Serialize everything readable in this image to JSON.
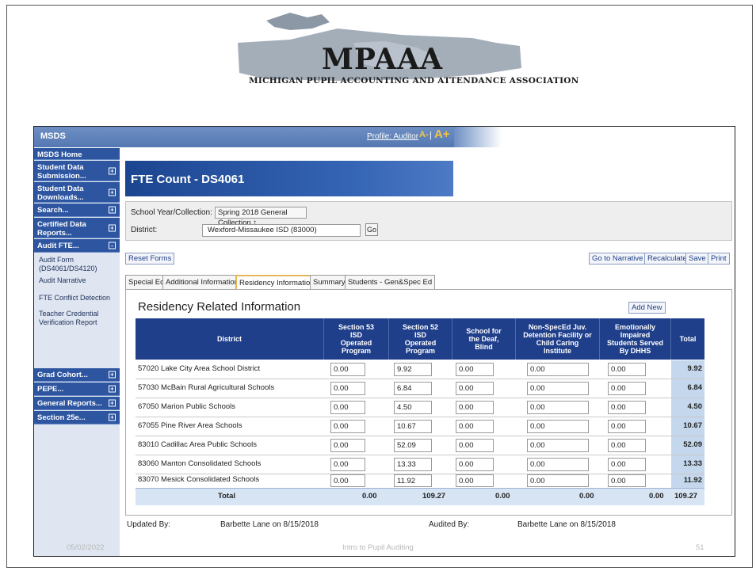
{
  "banner": {
    "title": "MPAAA",
    "subtitle": "MICHIGAN PUPIL ACCOUNTING AND ATTENDANCE ASSOCIATION"
  },
  "app": {
    "name": "MSDS",
    "profile_link": "Profile: Auditor",
    "font_small": "A-",
    "font_separator": "|",
    "font_large": "A+"
  },
  "sidebar": {
    "items": [
      {
        "label": "MSDS Home",
        "expand": ""
      },
      {
        "label": "Student Data Submission...",
        "expand": "+"
      },
      {
        "label": "Student Data Downloads...",
        "expand": "+"
      },
      {
        "label": "Search...",
        "expand": "+"
      },
      {
        "label": "Certified Data Reports...",
        "expand": "+"
      },
      {
        "label": "Audit FTE...",
        "expand": "-"
      },
      {
        "label": "Grad Cohort...",
        "expand": "+"
      },
      {
        "label": "PEPE...",
        "expand": "+"
      },
      {
        "label": "General Reports...",
        "expand": "+"
      },
      {
        "label": "Section 25e...",
        "expand": "+"
      }
    ],
    "audit_sub_items": [
      "Audit Form (DS4061/DS4120)",
      "Audit Narrative",
      "FTE Conflict Detection",
      "Teacher Credential Verification Report"
    ]
  },
  "page": {
    "title": "FTE Count - DS4061"
  },
  "filters": {
    "school_year_label": "School Year/Collection:",
    "school_year_value": "Spring 2018 General Collection ↕",
    "district_label": "District:",
    "district_value": "Wexford-Missaukee ISD (83000)",
    "go_label": "Go"
  },
  "toolbar": {
    "reset": "Reset Forms",
    "narrative": "Go to Narrative",
    "recalculate": "Recalculate",
    "save": "Save",
    "print": "Print"
  },
  "tabs": [
    {
      "label": "Special Ed",
      "active": false
    },
    {
      "label": "Additional Information",
      "active": false
    },
    {
      "label": "Residency Information",
      "active": true
    },
    {
      "label": "Summary",
      "active": false
    },
    {
      "label": "Students - Gen&Spec Ed",
      "active": false
    }
  ],
  "section": {
    "title": "Residency Related Information",
    "add_new": "Add New"
  },
  "table": {
    "headers": [
      "District",
      "Section 53 ISD Operated Program",
      "Section 52 ISD Operated Program",
      "School for the Deaf, Blind",
      "Non-SpecEd Juv. Detention Facility or Child Caring Institute",
      "Emotionally Impaired Students Served By DHHS",
      "Total"
    ],
    "rows": [
      {
        "district": "57020 Lake City Area School District",
        "s53": "0.00",
        "s52": "9.92",
        "deaf": "0.00",
        "juv": "0.00",
        "ei": "0.00",
        "total": "9.92"
      },
      {
        "district": "57030 McBain Rural Agricultural Schools",
        "s53": "0.00",
        "s52": "6.84",
        "deaf": "0.00",
        "juv": "0.00",
        "ei": "0.00",
        "total": "6.84"
      },
      {
        "district": "67050 Marion Public Schools",
        "s53": "0.00",
        "s52": "4.50",
        "deaf": "0.00",
        "juv": "0.00",
        "ei": "0.00",
        "total": "4.50"
      },
      {
        "district": "67055 Pine River Area Schools",
        "s53": "0.00",
        "s52": "10.67",
        "deaf": "0.00",
        "juv": "0.00",
        "ei": "0.00",
        "total": "10.67"
      },
      {
        "district": "83010 Cadillac Area Public Schools",
        "s53": "0.00",
        "s52": "52.09",
        "deaf": "0.00",
        "juv": "0.00",
        "ei": "0.00",
        "total": "52.09"
      },
      {
        "district": "83060 Manton Consolidated Schools",
        "s53": "0.00",
        "s52": "13.33",
        "deaf": "0.00",
        "juv": "0.00",
        "ei": "0.00",
        "total": "13.33"
      },
      {
        "district": "83070 Mesick Consolidated Schools",
        "s53": "0.00",
        "s52": "11.92",
        "deaf": "0.00",
        "juv": "0.00",
        "ei": "0.00",
        "total": "11.92"
      }
    ],
    "totals": {
      "label": "Total",
      "s53": "0.00",
      "s52": "109.27",
      "deaf": "0.00",
      "juv": "0.00",
      "ei": "0.00",
      "total": "109.27"
    }
  },
  "footer": {
    "updated_by_label": "Updated By:",
    "updated_by_value": "Barbette Lane on 8/15/2018",
    "audited_by_label": "Audited By:",
    "audited_by_value": "Barbette Lane on 8/15/2018"
  },
  "slide_footer": {
    "date": "05/02/2022",
    "title": "Intro to Pupil Auditing",
    "page": "51"
  }
}
